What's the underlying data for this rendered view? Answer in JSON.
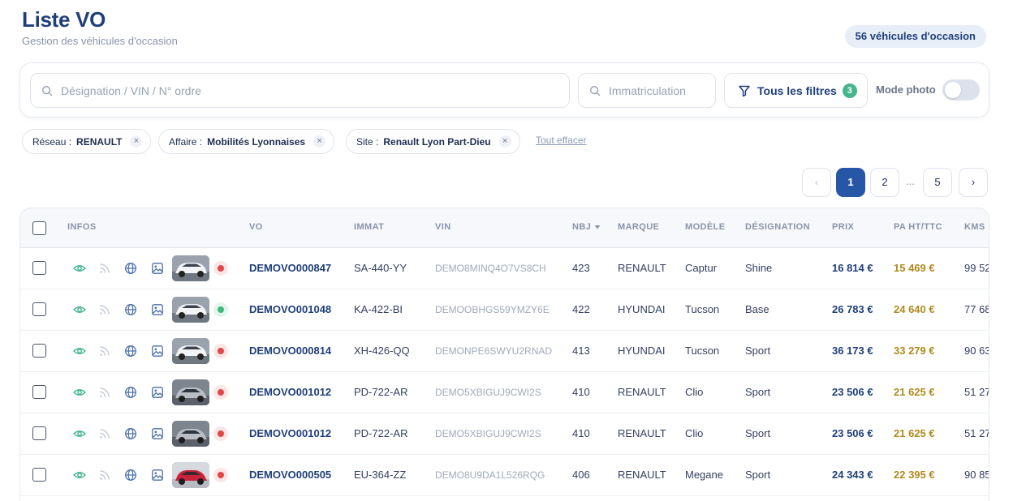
{
  "header": {
    "title": "Liste VO",
    "subtitle": "Gestion des véhicules d'occasion",
    "count_label": "56 véhicules d'occasion"
  },
  "search": {
    "main_placeholder": "Désignation / VIN / N° ordre",
    "immat_placeholder": "Immatriculation",
    "filters_label": "Tous les filtres",
    "filters_count": "3",
    "mode_photo_label": "Mode photo",
    "mode_photo_on": false
  },
  "chips": [
    {
      "key": "Réseau :",
      "value": "RENAULT"
    },
    {
      "key": "Affaire :",
      "value": "Mobilités Lyonnaises"
    },
    {
      "key": "Site :",
      "value": "Renault Lyon Part-Dieu"
    }
  ],
  "clear_all_label": "Tout effacer",
  "pagination": {
    "prev": "‹",
    "pages": [
      "1",
      "2",
      "5"
    ],
    "ellipsis": "...",
    "next": "›",
    "current": "1"
  },
  "table": {
    "headers": {
      "infos": "INFOS",
      "vo": "VO",
      "immat": "IMMAT",
      "vin": "VIN",
      "nbj": "NBJ",
      "marque": "MARQUE",
      "modele": "MODÈLE",
      "designation": "DÉSIGNATION",
      "prix": "PRIX",
      "pa": "PA HT/TTC",
      "kms": "KMS"
    },
    "rows": [
      {
        "vo": "DEMOVO000847",
        "immat": "SA-440-YY",
        "vin": "DEMO8MINQ4O7VS8CH",
        "nbj": "423",
        "marque": "RENAULT",
        "modele": "Captur",
        "designation": "Shine",
        "prix": "16 814 €",
        "pa": "15 469 €",
        "kms": "99 52",
        "status": "red",
        "thumb": "white-suv"
      },
      {
        "vo": "DEMOVO001048",
        "immat": "KA-422-BI",
        "vin": "DEMOOBHGS59YMZY6E",
        "nbj": "422",
        "marque": "HYUNDAI",
        "modele": "Tucson",
        "designation": "Base",
        "prix": "26 783 €",
        "pa": "24 640 €",
        "kms": "77 68",
        "status": "green",
        "thumb": "white-suv"
      },
      {
        "vo": "DEMOVO000814",
        "immat": "XH-426-QQ",
        "vin": "DEMONPE6SWYU2RNAD",
        "nbj": "413",
        "marque": "HYUNDAI",
        "modele": "Tucson",
        "designation": "Sport",
        "prix": "36 173 €",
        "pa": "33 279 €",
        "kms": "90 63",
        "status": "red",
        "thumb": "white-suv"
      },
      {
        "vo": "DEMOVO001012",
        "immat": "PD-722-AR",
        "vin": "DEMO5XBIGUJ9CWI2S",
        "nbj": "410",
        "marque": "RENAULT",
        "modele": "Clio",
        "designation": "Sport",
        "prix": "23 506 €",
        "pa": "21 625 €",
        "kms": "51 27",
        "status": "red",
        "thumb": "grey-hatch"
      },
      {
        "vo": "DEMOVO001012",
        "immat": "PD-722-AR",
        "vin": "DEMO5XBIGUJ9CWI2S",
        "nbj": "410",
        "marque": "RENAULT",
        "modele": "Clio",
        "designation": "Sport",
        "prix": "23 506 €",
        "pa": "21 625 €",
        "kms": "51 27",
        "status": "red",
        "thumb": "grey-hatch"
      },
      {
        "vo": "DEMOVO000505",
        "immat": "EU-364-ZZ",
        "vin": "DEMO8U9DA1L526RQG",
        "nbj": "406",
        "marque": "RENAULT",
        "modele": "Megane",
        "designation": "Sport",
        "prix": "24 343 €",
        "pa": "22 395 €",
        "kms": "90 85",
        "status": "red",
        "thumb": "red-hatch"
      }
    ]
  },
  "colors": {
    "accent": "#2856a6",
    "title": "#1f3f7a",
    "status_red": "#e04848",
    "status_green": "#3fb97a",
    "pa_gold": "#b08a1e",
    "eye_green": "#45b58e"
  }
}
